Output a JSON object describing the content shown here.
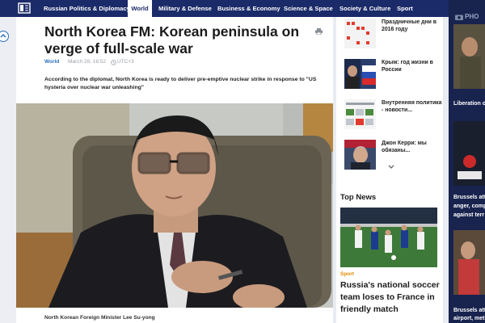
{
  "nav": {
    "items": [
      {
        "label": "Russian Politics & Diplomacy"
      },
      {
        "label": "World"
      },
      {
        "label": "Military & Defense"
      },
      {
        "label": "Business & Economy"
      },
      {
        "label": "Science & Space"
      },
      {
        "label": "Society & Culture"
      },
      {
        "label": "Sport"
      }
    ]
  },
  "article": {
    "title": "North Korea FM: Korean peninsula on verge of full-scale war",
    "category": "World",
    "date": "March 28, 16:52",
    "timezone": "UTC+3",
    "lead": "According to the diplomat, North Korea is ready to deliver pre-emptive nuclear strike in response to \"US hysteria over nuclear war unleashing\"",
    "caption": "North Korean Foreign Minister Lee Su-yong"
  },
  "sidebar": {
    "items": [
      {
        "title": "Праздничные дни в 2016 году"
      },
      {
        "title": "Крым: год жизни в России"
      },
      {
        "title": "Внутренняя политика - новости..."
      },
      {
        "title": "Джон Керри: мы обязаны..."
      }
    ],
    "top_news": {
      "heading": "Top News",
      "category": "Sport",
      "title": "Russia's national soccer team loses to France in friendly match"
    }
  },
  "right_column": {
    "tab_label": "PHO",
    "items": [
      {
        "text": "Liberation o"
      },
      {
        "text": "Brussels att"
      },
      {
        "text": "anger, comp"
      },
      {
        "text": "against terr"
      },
      {
        "text": "Brussels att"
      },
      {
        "text": "airport, met"
      }
    ]
  },
  "colors": {
    "nav_bg": "#1b2a68",
    "link_blue": "#2a6fbf",
    "sport_orange": "#e08a00",
    "right_bg": "#18234e"
  }
}
